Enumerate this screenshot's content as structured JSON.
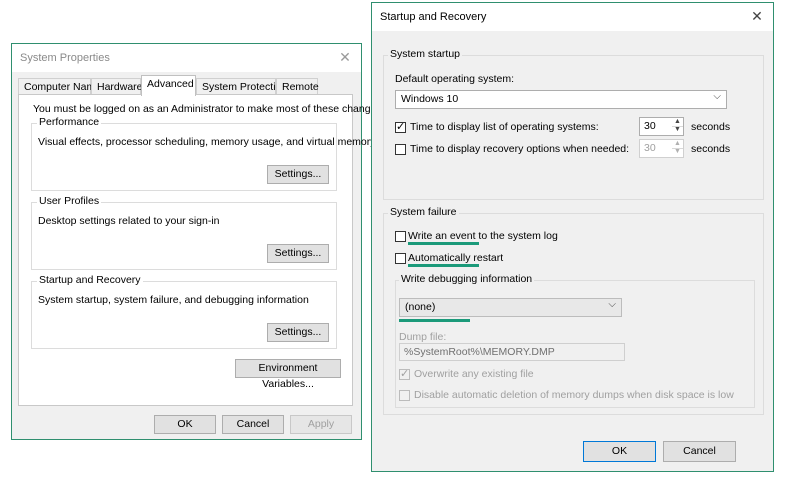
{
  "system_properties": {
    "title": "System Properties",
    "tabs": [
      "Computer Name",
      "Hardware",
      "Advanced",
      "System Protection",
      "Remote"
    ],
    "active_tab": "Advanced",
    "admin_note": "You must be logged on as an Administrator to make most of these changes.",
    "performance": {
      "legend": "Performance",
      "description": "Visual effects, processor scheduling, memory usage, and virtual memory",
      "button": "Settings..."
    },
    "user_profiles": {
      "legend": "User Profiles",
      "description": "Desktop settings related to your sign-in",
      "button": "Settings..."
    },
    "startup_recovery": {
      "legend": "Startup and Recovery",
      "description": "System startup, system failure, and debugging information",
      "button": "Settings..."
    },
    "env_button": "Environment Variables...",
    "ok": "OK",
    "cancel": "Cancel",
    "apply": "Apply"
  },
  "startup_recovery": {
    "title": "Startup and Recovery",
    "system_startup": {
      "legend": "System startup",
      "default_os_label": "Default operating system:",
      "default_os_value": "Windows 10",
      "time_list_label": "Time to display list of operating systems:",
      "time_list_checked": true,
      "time_list_value": "30",
      "time_recovery_label": "Time to display recovery options when needed:",
      "time_recovery_checked": false,
      "time_recovery_value": "30",
      "seconds_label": "seconds"
    },
    "system_failure": {
      "legend": "System failure",
      "write_event_label": "Write an event to the system log",
      "write_event_checked": false,
      "auto_restart_label": "Automatically restart",
      "auto_restart_checked": false,
      "debug_info_label": "Write debugging information",
      "debug_info_value": "(none)",
      "dump_file_label": "Dump file:",
      "dump_file_value": "%SystemRoot%\\MEMORY.DMP",
      "overwrite_label": "Overwrite any existing file",
      "overwrite_checked": true,
      "disable_auto_delete_label": "Disable automatic deletion of memory dumps when disk space is low",
      "disable_auto_delete_checked": false
    },
    "ok": "OK",
    "cancel": "Cancel"
  },
  "colors": {
    "accent_border": "#2f8f6f",
    "highlight_underline": "#1b9a7a",
    "default_button_border": "#0078d7"
  },
  "icons": {
    "close": "close-icon",
    "dropdown": "chevron-down-icon",
    "spin_up": "spin-up-icon",
    "spin_down": "spin-down-icon"
  }
}
